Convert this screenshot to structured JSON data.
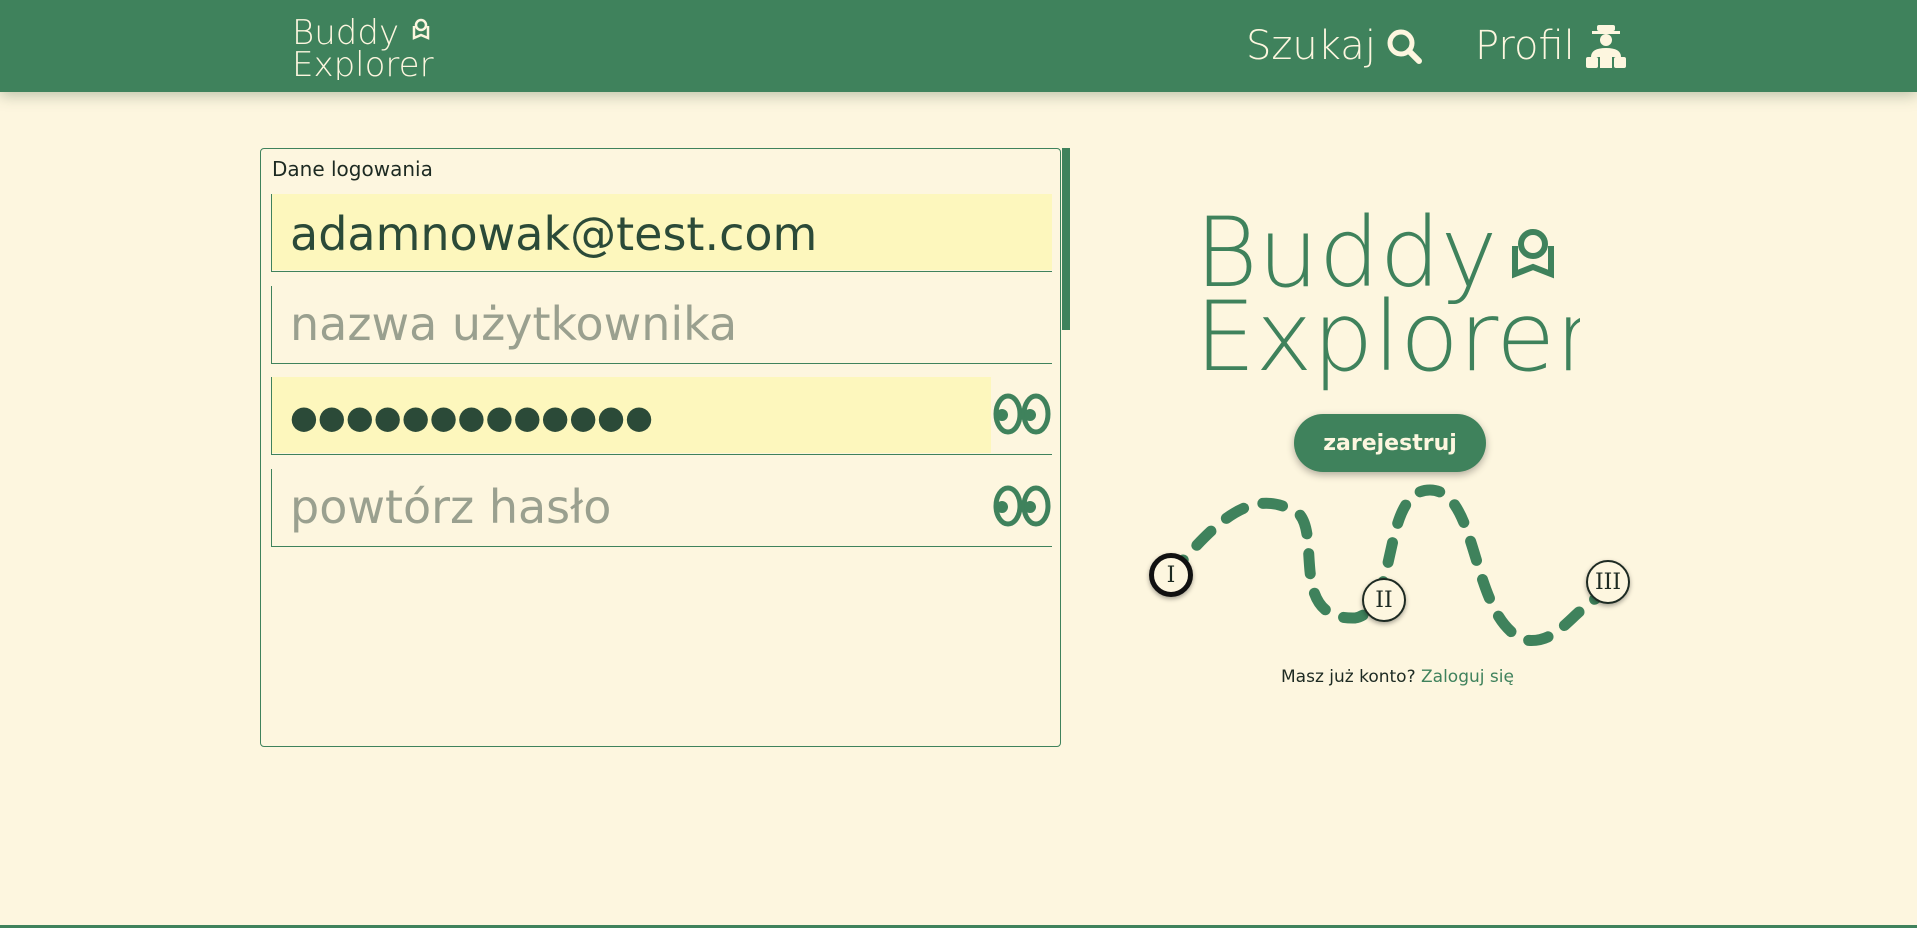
{
  "header": {
    "logo": {
      "line1": "Buddy",
      "line2": "Explorer"
    },
    "nav": {
      "search_label": "Szukaj",
      "search_icon": "search-icon",
      "profile_label": "Profil",
      "profile_icon": "explorer-avatar-icon"
    }
  },
  "form": {
    "legend": "Dane logowania",
    "email_value": "adamnowak@test.com",
    "username_placeholder": "nazwa użytkownika",
    "password_mask": "●●●●●●●●●●●●●",
    "password_repeat_placeholder": "powtórz hasło",
    "show_password_icon": "eyes-icon"
  },
  "side": {
    "logo": {
      "line1": "Buddy",
      "line2": "Explorer"
    },
    "register_label": "zarejestruj",
    "steps": [
      "I",
      "II",
      "III"
    ],
    "active_step": 1,
    "login_prompt": "Masz już konto?",
    "login_link": "Zaloguj się"
  },
  "colors": {
    "primary": "#3f825c",
    "background": "#fdf6df",
    "autofill": "#fdf7bd",
    "text_dark": "#2b4a38",
    "placeholder": "#9aa08f"
  }
}
